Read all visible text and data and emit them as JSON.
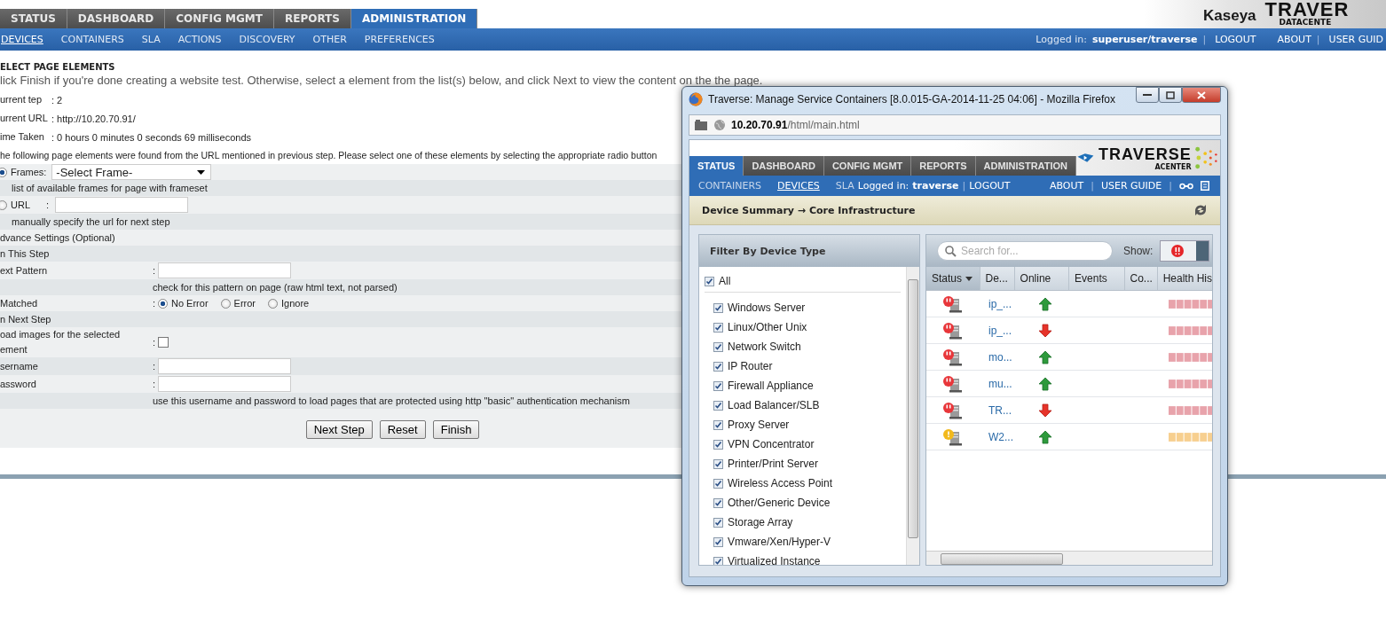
{
  "main_tabs": [
    {
      "label": "STATUS",
      "selected": false
    },
    {
      "label": "DASHBOARD",
      "selected": false
    },
    {
      "label": "CONFIG MGMT",
      "selected": false
    },
    {
      "label": "REPORTS",
      "selected": false
    },
    {
      "label": "ADMINISTRATION",
      "selected": true
    }
  ],
  "logo": {
    "brand": "Kaseya",
    "product": "TRAVER",
    "tagline": "DATACENTE"
  },
  "sub_nav": [
    {
      "label": "DEVICES",
      "selected": true
    },
    {
      "label": "CONTAINERS",
      "selected": false
    },
    {
      "label": "SLA",
      "selected": false
    },
    {
      "label": "ACTIONS",
      "selected": false
    },
    {
      "label": "DISCOVERY",
      "selected": false
    },
    {
      "label": "OTHER",
      "selected": false
    },
    {
      "label": "PREFERENCES",
      "selected": false
    }
  ],
  "user_bar": [
    {
      "kind": "label",
      "text": "Logged in:"
    },
    {
      "kind": "user",
      "text": "superuser/traverse"
    },
    {
      "kind": "sep",
      "text": "|"
    },
    {
      "kind": "link",
      "text": "LOGOUT"
    },
    {
      "kind": "link",
      "text": "ABOUT"
    },
    {
      "kind": "sep",
      "text": "|"
    },
    {
      "kind": "link",
      "text": "USER GUID"
    }
  ],
  "form": {
    "title": "ELECT PAGE ELEMENTS",
    "intro": "lick Finish if you're done creating a website test. Otherwise, select a element from the list(s) below, and click Next to view the content on the the page.",
    "info": [
      {
        "label": "urrent tep",
        "value": ": 2"
      },
      {
        "label": "urrent URL",
        "value": ": http://10.20.70.91/"
      },
      {
        "label": "ime Taken",
        "value": ": 0 hours 0 minutes 0 seconds 69 milliseconds"
      }
    ],
    "found_note": "he following page elements were found from the URL mentioned in previous step. Please select one of these elements by selecting the appropriate radio button",
    "rows": [
      {
        "kind": "radio_select",
        "label": "Frames:",
        "selected": true,
        "value": "-Select Frame-"
      },
      {
        "kind": "hint",
        "text": "list of available frames for page with frameset"
      },
      {
        "kind": "radio_input",
        "label": "URL",
        "selected": false,
        "colon": ":"
      },
      {
        "kind": "hint",
        "text": "manually specify the url for next step"
      },
      {
        "kind": "section",
        "text": "dvance Settings (Optional)"
      },
      {
        "kind": "section",
        "text": "n This Step"
      },
      {
        "kind": "input",
        "label": "ext Pattern",
        "colon": ":"
      },
      {
        "kind": "hint2",
        "text": "check for this pattern on page (raw html text, not parsed)"
      },
      {
        "kind": "radios",
        "label": "Matched",
        "colon": ":",
        "options": [
          {
            "label": "No Error",
            "selected": true
          },
          {
            "label": "Error",
            "selected": false
          },
          {
            "label": "Ignore",
            "selected": false
          }
        ]
      },
      {
        "kind": "section",
        "text": "n Next Step"
      },
      {
        "kind": "checkbox",
        "label": "oad images for the selected ement",
        "colon": ":",
        "checked": false
      },
      {
        "kind": "input",
        "label": "sername",
        "colon": ":"
      },
      {
        "kind": "input",
        "label": "assword",
        "colon": ":"
      },
      {
        "kind": "hint2",
        "text": "use this username and password to load pages that are protected using http \"basic\" authentication mechanism"
      }
    ],
    "buttons": [
      "Next Step",
      "Reset",
      "Finish"
    ]
  },
  "browser": {
    "title": "Traverse: Manage Service Containers [8.0.015-GA-2014-11-25 04:06] - Mozilla Firefox",
    "url_host": "10.20.70.91",
    "url_path": "/html/main.html"
  },
  "app": {
    "logo": "TRAVERSE",
    "logo_sub": "ACENTER",
    "tabs": [
      {
        "label": "STATUS",
        "selected": true
      },
      {
        "label": "DASHBOARD",
        "selected": false
      },
      {
        "label": "CONFIG MGMT",
        "selected": false
      },
      {
        "label": "REPORTS",
        "selected": false
      },
      {
        "label": "ADMINISTRATION",
        "selected": false
      }
    ],
    "sub_nav": [
      {
        "label": "CONTAINERS",
        "selected": false
      },
      {
        "label": "DEVICES",
        "selected": true
      },
      {
        "label": "SLA",
        "selected": false
      }
    ],
    "overlay": [
      {
        "kind": "label",
        "text": "Logged in:"
      },
      {
        "kind": "user",
        "text": "traverse"
      },
      {
        "kind": "sep",
        "text": "|"
      },
      {
        "kind": "link",
        "text": "LOGOUT"
      }
    ],
    "right_links": [
      {
        "kind": "link",
        "text": "ABOUT"
      },
      {
        "kind": "sep",
        "text": "|"
      },
      {
        "kind": "link",
        "text": "USER GUIDE"
      },
      {
        "kind": "sep",
        "text": "|"
      }
    ],
    "breadcrumb": "Device Summary → Core Infrastructure",
    "filter": {
      "title": "Filter By Device Type",
      "all": {
        "label": "All",
        "checked": true
      },
      "types": [
        {
          "label": "Windows Server",
          "checked": true
        },
        {
          "label": "Linux/Other Unix",
          "checked": true
        },
        {
          "label": "Network Switch",
          "checked": true
        },
        {
          "label": "IP Router",
          "checked": true
        },
        {
          "label": "Firewall Appliance",
          "checked": true
        },
        {
          "label": "Load Balancer/SLB",
          "checked": true
        },
        {
          "label": "Proxy Server",
          "checked": true
        },
        {
          "label": "VPN Concentrator",
          "checked": true
        },
        {
          "label": "Printer/Print Server",
          "checked": true
        },
        {
          "label": "Wireless Access Point",
          "checked": true
        },
        {
          "label": "Other/Generic Device",
          "checked": true
        },
        {
          "label": "Storage Array",
          "checked": true
        },
        {
          "label": "Vmware/Xen/Hyper-V",
          "checked": true
        },
        {
          "label": "Virtualized Instance",
          "checked": true
        }
      ]
    },
    "devices": {
      "search_placeholder": "Search for...",
      "show_label": "Show:",
      "columns": [
        "Status",
        "De...",
        "Online",
        "Events",
        "Co...",
        "Health His"
      ],
      "rows": [
        {
          "kind": "critical",
          "name": "ip_...",
          "online": true
        },
        {
          "kind": "critical",
          "name": "ip_...",
          "online": false
        },
        {
          "kind": "critical",
          "name": "mo...",
          "online": true
        },
        {
          "kind": "critical",
          "name": "mu...",
          "online": true
        },
        {
          "kind": "critical",
          "name": "TR...",
          "online": false
        },
        {
          "kind": "warning",
          "name": "W2...",
          "online": true
        }
      ]
    }
  }
}
